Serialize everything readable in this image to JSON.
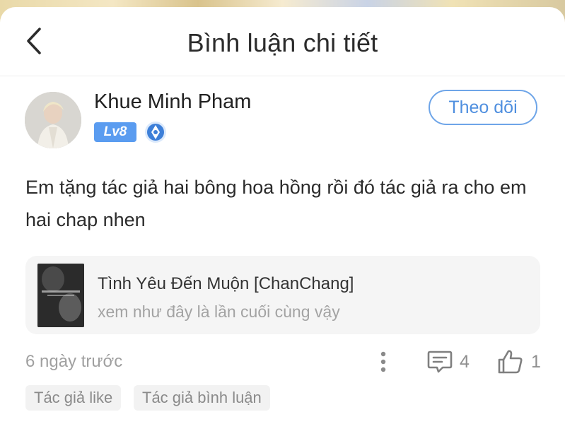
{
  "header": {
    "title": "Bình luận chi tiết"
  },
  "comment": {
    "user_name": "Khue Minh Pham",
    "level": "Lv8",
    "follow_label": "Theo dõi",
    "text": "Em tặng tác giả hai bông hoa hồng rồi đó tác giả ra cho em hai chap nhen",
    "book": {
      "title": "Tình Yêu Đến Muộn [ChanChang]",
      "subtitle": "xem như đây là lần cuối cùng vậy"
    },
    "timestamp": "6 ngày trước",
    "reply_count": "4",
    "like_count": "1",
    "tags": [
      "Tác giả like",
      "Tác giả bình luận"
    ]
  },
  "colors": {
    "accent": "#4f8fdf",
    "level_badge": "#5a9cf0",
    "muted_text": "#a0a0a0"
  },
  "icons": {
    "back": "chevron-left-icon",
    "medal": "medal-icon",
    "more": "more-vertical-icon",
    "comment": "comment-icon",
    "like": "thumbs-up-icon"
  }
}
